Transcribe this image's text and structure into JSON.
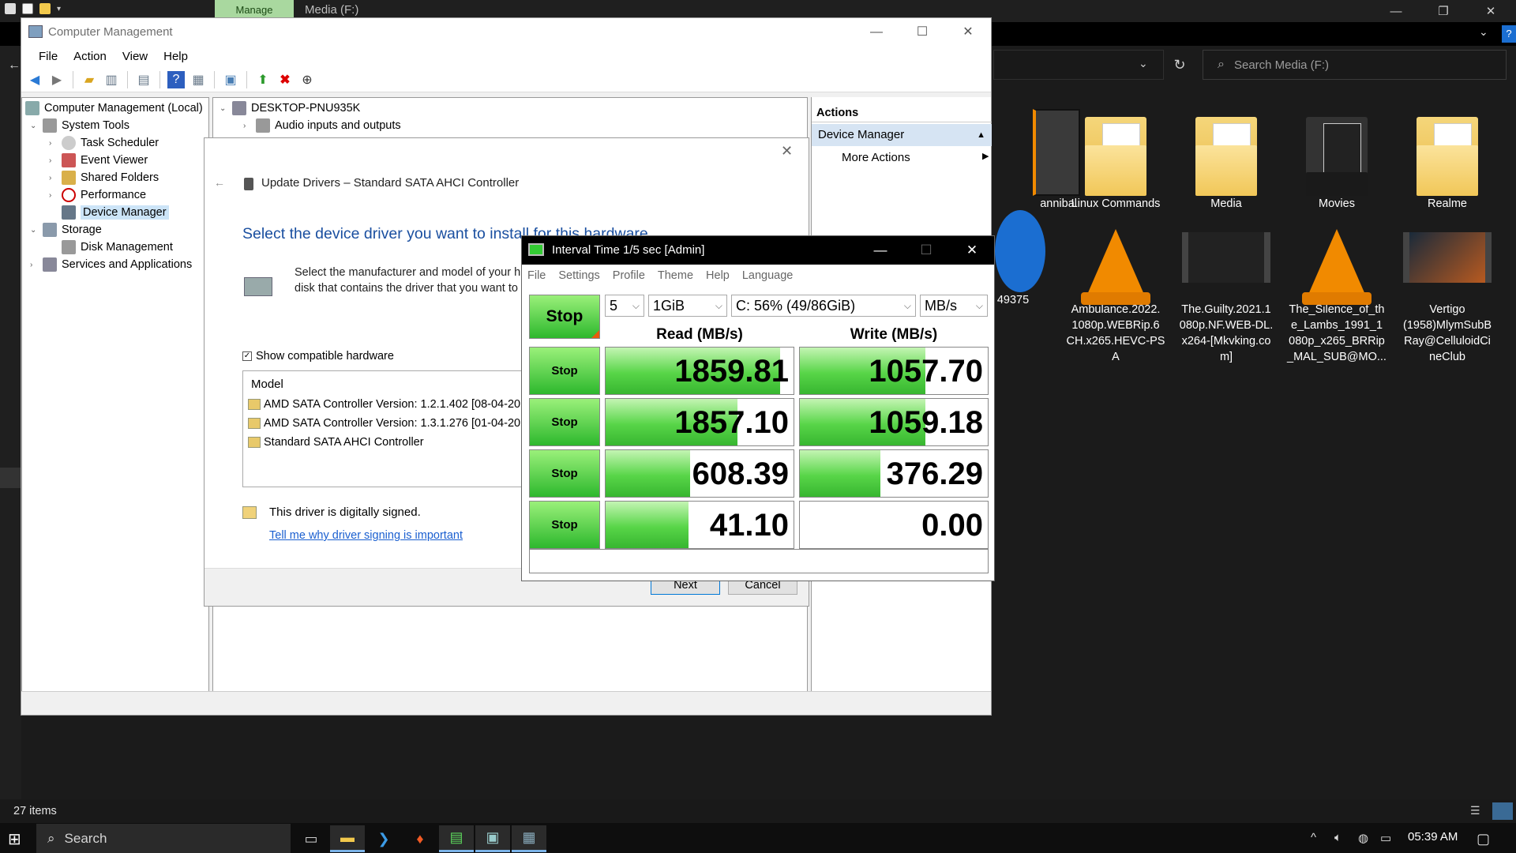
{
  "explorer": {
    "tab_manage": "Manage",
    "title": "Media (F:)",
    "search_placeholder": "Search Media (F:)",
    "status_items": "27 items",
    "files": [
      {
        "name": "annibal",
        "kind": "video"
      },
      {
        "name": "Linux Commands",
        "kind": "folder"
      },
      {
        "name": "Media",
        "kind": "folder"
      },
      {
        "name": "Movies",
        "kind": "folder"
      },
      {
        "name": "Realme",
        "kind": "folder"
      },
      {
        "name": "49375",
        "kind": "shortcut"
      },
      {
        "name": "Ambulance.2022.1080p.WEBRip.6CH.x265.HEVC-PSA",
        "kind": "vlc"
      },
      {
        "name": "The.Guilty.2021.1080p.NF.WEB-DL.x264-[Mkvking.com]",
        "kind": "video"
      },
      {
        "name": "The_Silence_of_the_Lambs_1991_1080p_x265_BRRip_MAL_SUB@MO...",
        "kind": "vlc"
      },
      {
        "name": "Vertigo (1958)MlymSubBRay@CelluloidCineClub",
        "kind": "video"
      }
    ]
  },
  "file_labels": {
    "f0": "annibal",
    "f1": "Linux Commands",
    "f2": "Media",
    "f3": "Movies",
    "f4": "Realme",
    "f5": "49375",
    "f6_l1": "Ambulance.2022.",
    "f6_l2": "1080p.WEBRip.6",
    "f6_l3": "CH.x265.HEVC-PS",
    "f6_l4": "A",
    "f7_l1": "The.Guilty.2021.1",
    "f7_l2": "080p.NF.WEB-DL.",
    "f7_l3": "x264-[Mkvking.co",
    "f7_l4": "m]",
    "f8_l1": "The_Silence_of_th",
    "f8_l2": "e_Lambs_1991_1",
    "f8_l3": "080p_x265_BRRip",
    "f8_l4": "_MAL_SUB@MO...",
    "f9_l1": "Vertigo",
    "f9_l2": "(1958)MlymSubB",
    "f9_l3": "Ray@CelluloidCi",
    "f9_l4": "neClub"
  },
  "taskbar": {
    "search_label": "Search",
    "clock": "05:39 AM"
  },
  "cm": {
    "title": "Computer Management",
    "menu": [
      "File",
      "Action",
      "View",
      "Help"
    ],
    "tree": {
      "root": "Computer Management (Local)",
      "system_tools": "System Tools",
      "task_scheduler": "Task Scheduler",
      "event_viewer": "Event Viewer",
      "shared_folders": "Shared Folders",
      "performance": "Performance",
      "device_manager": "Device Manager",
      "storage": "Storage",
      "disk_management": "Disk Management",
      "services": "Services and Applications"
    },
    "center": {
      "computer": "DESKTOP-PNU935K",
      "audio": "Audio inputs and outputs"
    },
    "actions": {
      "header": "Actions",
      "section": "Device Manager",
      "more": "More Actions"
    }
  },
  "update_drivers": {
    "title": "Update Drivers – Standard SATA AHCI Controller",
    "heading": "Select the device driver you want to install for this hardware.",
    "desc_line1": "Select the manufacturer and model of your h",
    "desc_line2": "disk that contains the driver that you want to",
    "show_compatible": "Show compatible hardware",
    "show_compatible_checked": true,
    "list_header": "Model",
    "models": [
      "AMD SATA Controller Version: 1.2.1.402 [08-04-2015",
      "AMD SATA Controller Version: 1.3.1.276 [01-04-2017",
      "Standard SATA AHCI Controller"
    ],
    "signed": "This driver is digitally signed.",
    "signing_link": "Tell me why driver signing is important",
    "next": "Next",
    "cancel": "Cancel"
  },
  "interval": {
    "title": "Interval Time 1/5 sec [Admin]",
    "menu": [
      "File",
      "Settings",
      "Profile",
      "Theme",
      "Help",
      "Language"
    ],
    "main_button": "Stop",
    "count": "5",
    "size": "1GiB",
    "drive": "C: 56% (49/86GiB)",
    "unit": "MB/s",
    "read_header": "Read (MB/s)",
    "write_header": "Write (MB/s)",
    "rows": [
      {
        "button": "Stop",
        "read": "1859.81",
        "read_fill": 0.93,
        "write": "1057.70",
        "write_fill": 0.67
      },
      {
        "button": "Stop",
        "read": "1857.10",
        "read_fill": 0.7,
        "write": "1059.18",
        "write_fill": 0.67
      },
      {
        "button": "Stop",
        "read": "608.39",
        "read_fill": 0.45,
        "write": "376.29",
        "write_fill": 0.43
      },
      {
        "button": "Stop",
        "read": "41.10",
        "read_fill": 0.44,
        "write": "0.00",
        "write_fill": 0.0
      }
    ],
    "comment": ""
  },
  "colors": {
    "bar_green": "#37b630",
    "manage_tab": "#a9d89f",
    "heading_blue": "#1a4fa0",
    "link_blue": "#1a5fd0"
  }
}
